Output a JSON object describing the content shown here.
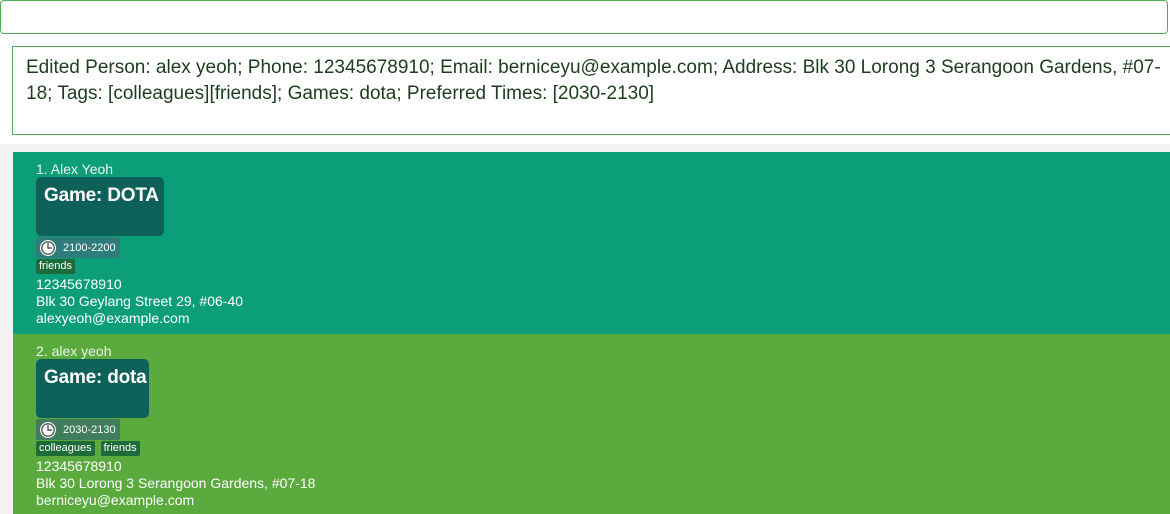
{
  "command_box": {
    "value": "",
    "placeholder": ""
  },
  "result": {
    "text": "Edited Person: alex yeoh; Phone: 12345678910; Email: berniceyu@example.com; Address: Blk 30 Lorong 3 Serangoon Gardens, #07-18; Tags: [colleagues][friends]; Games: dota; Preferred Times: [2030-2130]"
  },
  "persons": [
    {
      "name": "1. Alex Yeoh",
      "game": "Game: DOTA",
      "time": "2100-2200",
      "tags": [
        "friends"
      ],
      "phone": "12345678910",
      "address": "Blk 30 Geylang Street 29, #06-40",
      "email": "alexyeoh@example.com",
      "color": "#0b9e78"
    },
    {
      "name": "2. alex yeoh",
      "game": "Game: dota",
      "time": "2030-2130",
      "tags": [
        "colleagues",
        "friends"
      ],
      "phone": "12345678910",
      "address": "Blk 30 Lorong 3 Serangoon Gardens, #07-18",
      "email": "berniceyu@example.com",
      "color": "#5aaa3e"
    }
  ],
  "icons": {
    "time": "clock-icon"
  }
}
